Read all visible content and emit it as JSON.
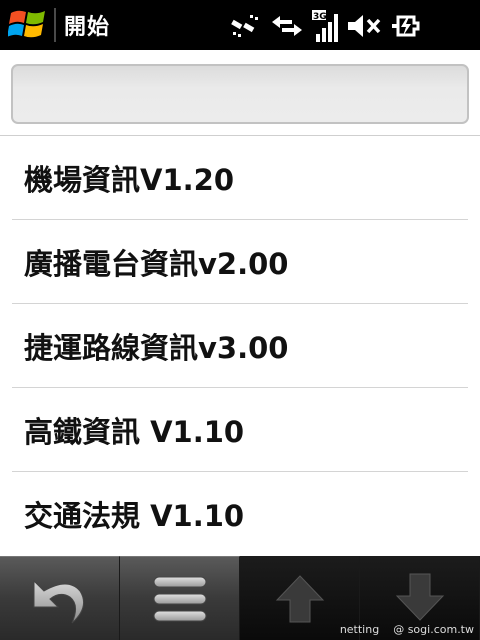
{
  "titlebar": {
    "title": "開始",
    "icons": [
      "windows-start-icon",
      "wifi-off-icon",
      "data-transfer-icon",
      "3g-signal-icon",
      "speaker-muted-icon",
      "battery-charging-icon"
    ]
  },
  "search": {
    "value": "",
    "placeholder": ""
  },
  "list": {
    "items": [
      {
        "label": "機場資訊V1.20"
      },
      {
        "label": "廣播電台資訊v2.00"
      },
      {
        "label": "捷運路線資訊v3.00"
      },
      {
        "label": "高鐵資訊 V1.10"
      },
      {
        "label": "交通法規 V1.10"
      }
    ]
  },
  "softkeys": {
    "icons": [
      "back-icon",
      "menu-icon",
      "arrow-up-icon",
      "arrow-down-icon"
    ]
  },
  "watermark": {
    "left": "netting",
    "right": "@ sogi.com.tw"
  },
  "colors": {
    "titlebar": "#000000",
    "background": "#ffffff",
    "text": "#111111"
  }
}
